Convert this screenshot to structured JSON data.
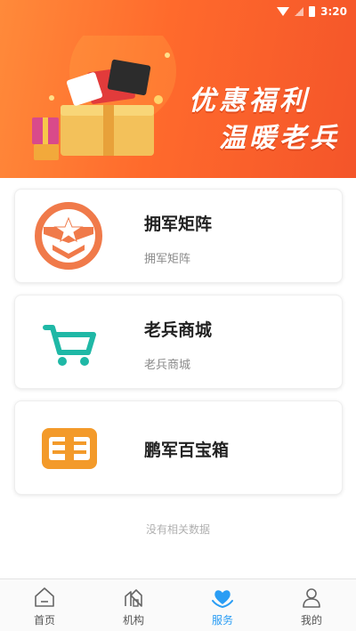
{
  "status_bar": {
    "time": "3:20"
  },
  "banner": {
    "line1": "优惠福利",
    "line2": "温暖老兵"
  },
  "cards": [
    {
      "title": "拥军矩阵",
      "subtitle": "拥军矩阵",
      "icon": "shield-star-icon",
      "color": "#f07a4a"
    },
    {
      "title": "老兵商城",
      "subtitle": "老兵商城",
      "icon": "shopping-cart-icon",
      "color": "#1fb8a6"
    },
    {
      "title": "鹏军百宝箱",
      "subtitle": "",
      "icon": "treasure-chest-icon",
      "color": "#f39a2a"
    }
  ],
  "empty_text": "没有相关数据",
  "tabbar": {
    "items": [
      {
        "label": "首页",
        "icon": "home-icon"
      },
      {
        "label": "机构",
        "icon": "building-icon"
      },
      {
        "label": "服务",
        "icon": "heart-hands-icon",
        "active": true
      },
      {
        "label": "我的",
        "icon": "user-icon"
      }
    ],
    "active_color": "#2a9df4"
  }
}
